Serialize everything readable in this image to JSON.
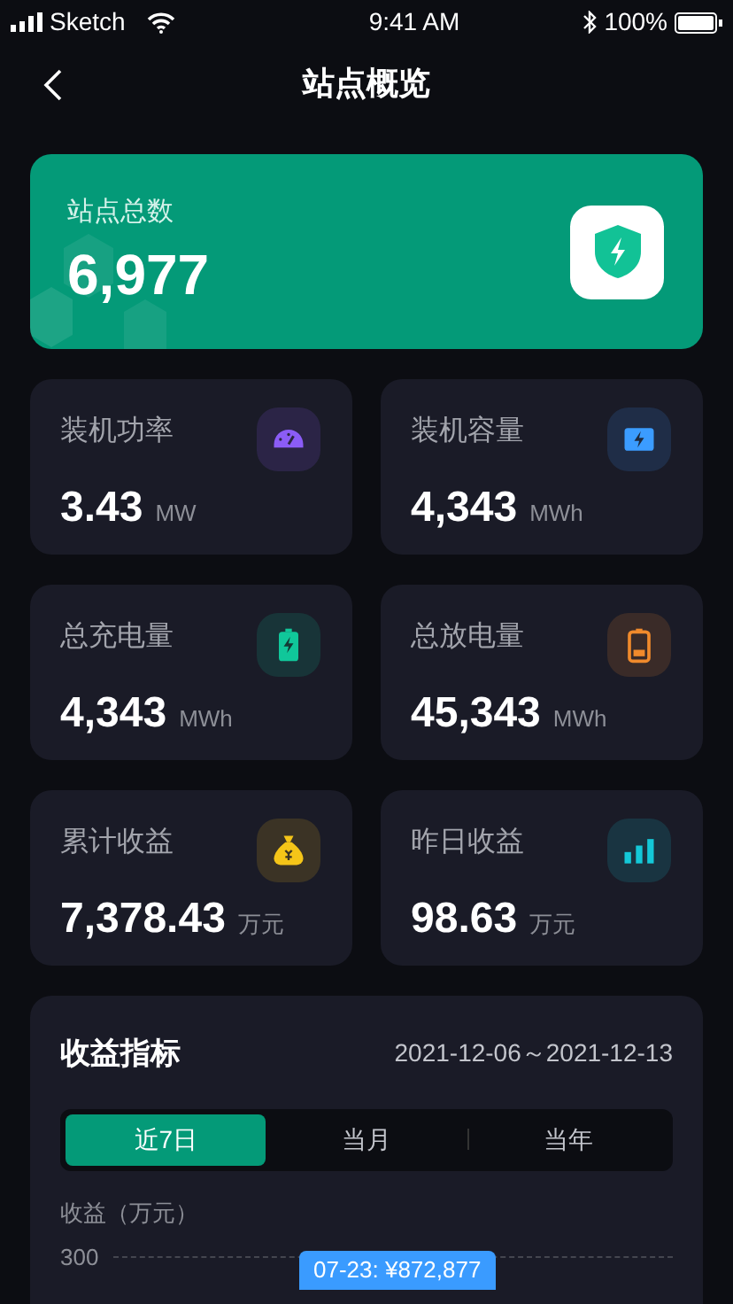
{
  "status_bar": {
    "carrier": "Sketch",
    "time": "9:41 AM",
    "battery": "100%"
  },
  "nav": {
    "title": "站点概览"
  },
  "hero": {
    "label": "站点总数",
    "value": "6,977"
  },
  "stats": [
    {
      "label": "装机功率",
      "value": "3.43",
      "unit": "MW",
      "kind": "gauge",
      "color": "#8b5cf6"
    },
    {
      "label": "装机容量",
      "value": "4,343",
      "unit": "MWh",
      "kind": "module",
      "color": "#3b9cff"
    },
    {
      "label": "总充电量",
      "value": "4,343",
      "unit": "MWh",
      "kind": "charge",
      "color": "#10c79a"
    },
    {
      "label": "总放电量",
      "value": "45,343",
      "unit": "MWh",
      "kind": "battery",
      "color": "#f08a2c"
    },
    {
      "label": "累计收益",
      "value": "7,378.43",
      "unit": "万元",
      "kind": "moneybag",
      "color": "#f5c518"
    },
    {
      "label": "昨日收益",
      "value": "98.63",
      "unit": "万元",
      "kind": "bars",
      "color": "#14c8d8"
    }
  ],
  "income": {
    "title": "收益指标",
    "range": "2021-12-06～2021-12-13",
    "tabs": [
      {
        "label": "近7日",
        "selected": true
      },
      {
        "label": "当月",
        "selected": false
      },
      {
        "label": "当年",
        "selected": false
      }
    ],
    "axis_title": "收益（万元）",
    "ytick": "300",
    "tooltip": "07-23: ¥872,877"
  }
}
